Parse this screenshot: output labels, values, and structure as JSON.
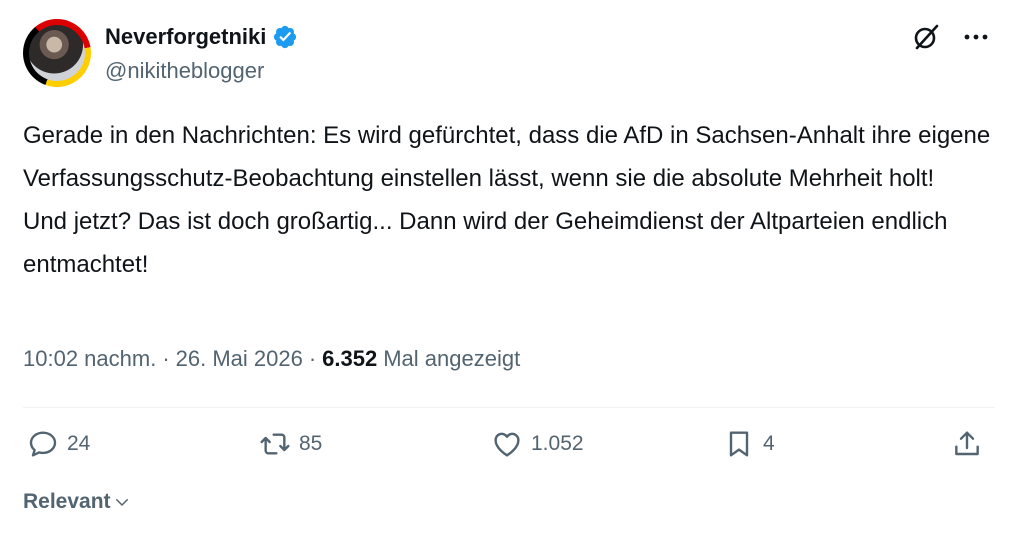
{
  "author": {
    "display_name": "Neverforgetniki",
    "handle": "@nikitheblogger",
    "verified": true
  },
  "tweet": {
    "lines": [
      "Gerade in den Nachrichten: Es wird gefürchtet, dass die AfD in Sachsen-Anhalt ihre eigene Verfassungsschutz-Beobachtung einstellen lässt, wenn sie die absolute Mehrheit holt!",
      "Und jetzt? Das ist doch großartig... Dann wird der Geheimdienst der Altparteien endlich entmachtet!"
    ]
  },
  "meta": {
    "time": "10:02 nachm.",
    "sep1": "·",
    "date": "26. Mai 2026",
    "sep2": "·",
    "views": "6.352",
    "views_label": "Mal angezeigt"
  },
  "actions": {
    "replies": "24",
    "reposts": "85",
    "likes": "1.052",
    "bookmarks": "4"
  },
  "sort": {
    "label": "Relevant"
  },
  "colors": {
    "verified": "#1d9bf0",
    "muted": "#536471",
    "text": "#0f1419"
  }
}
